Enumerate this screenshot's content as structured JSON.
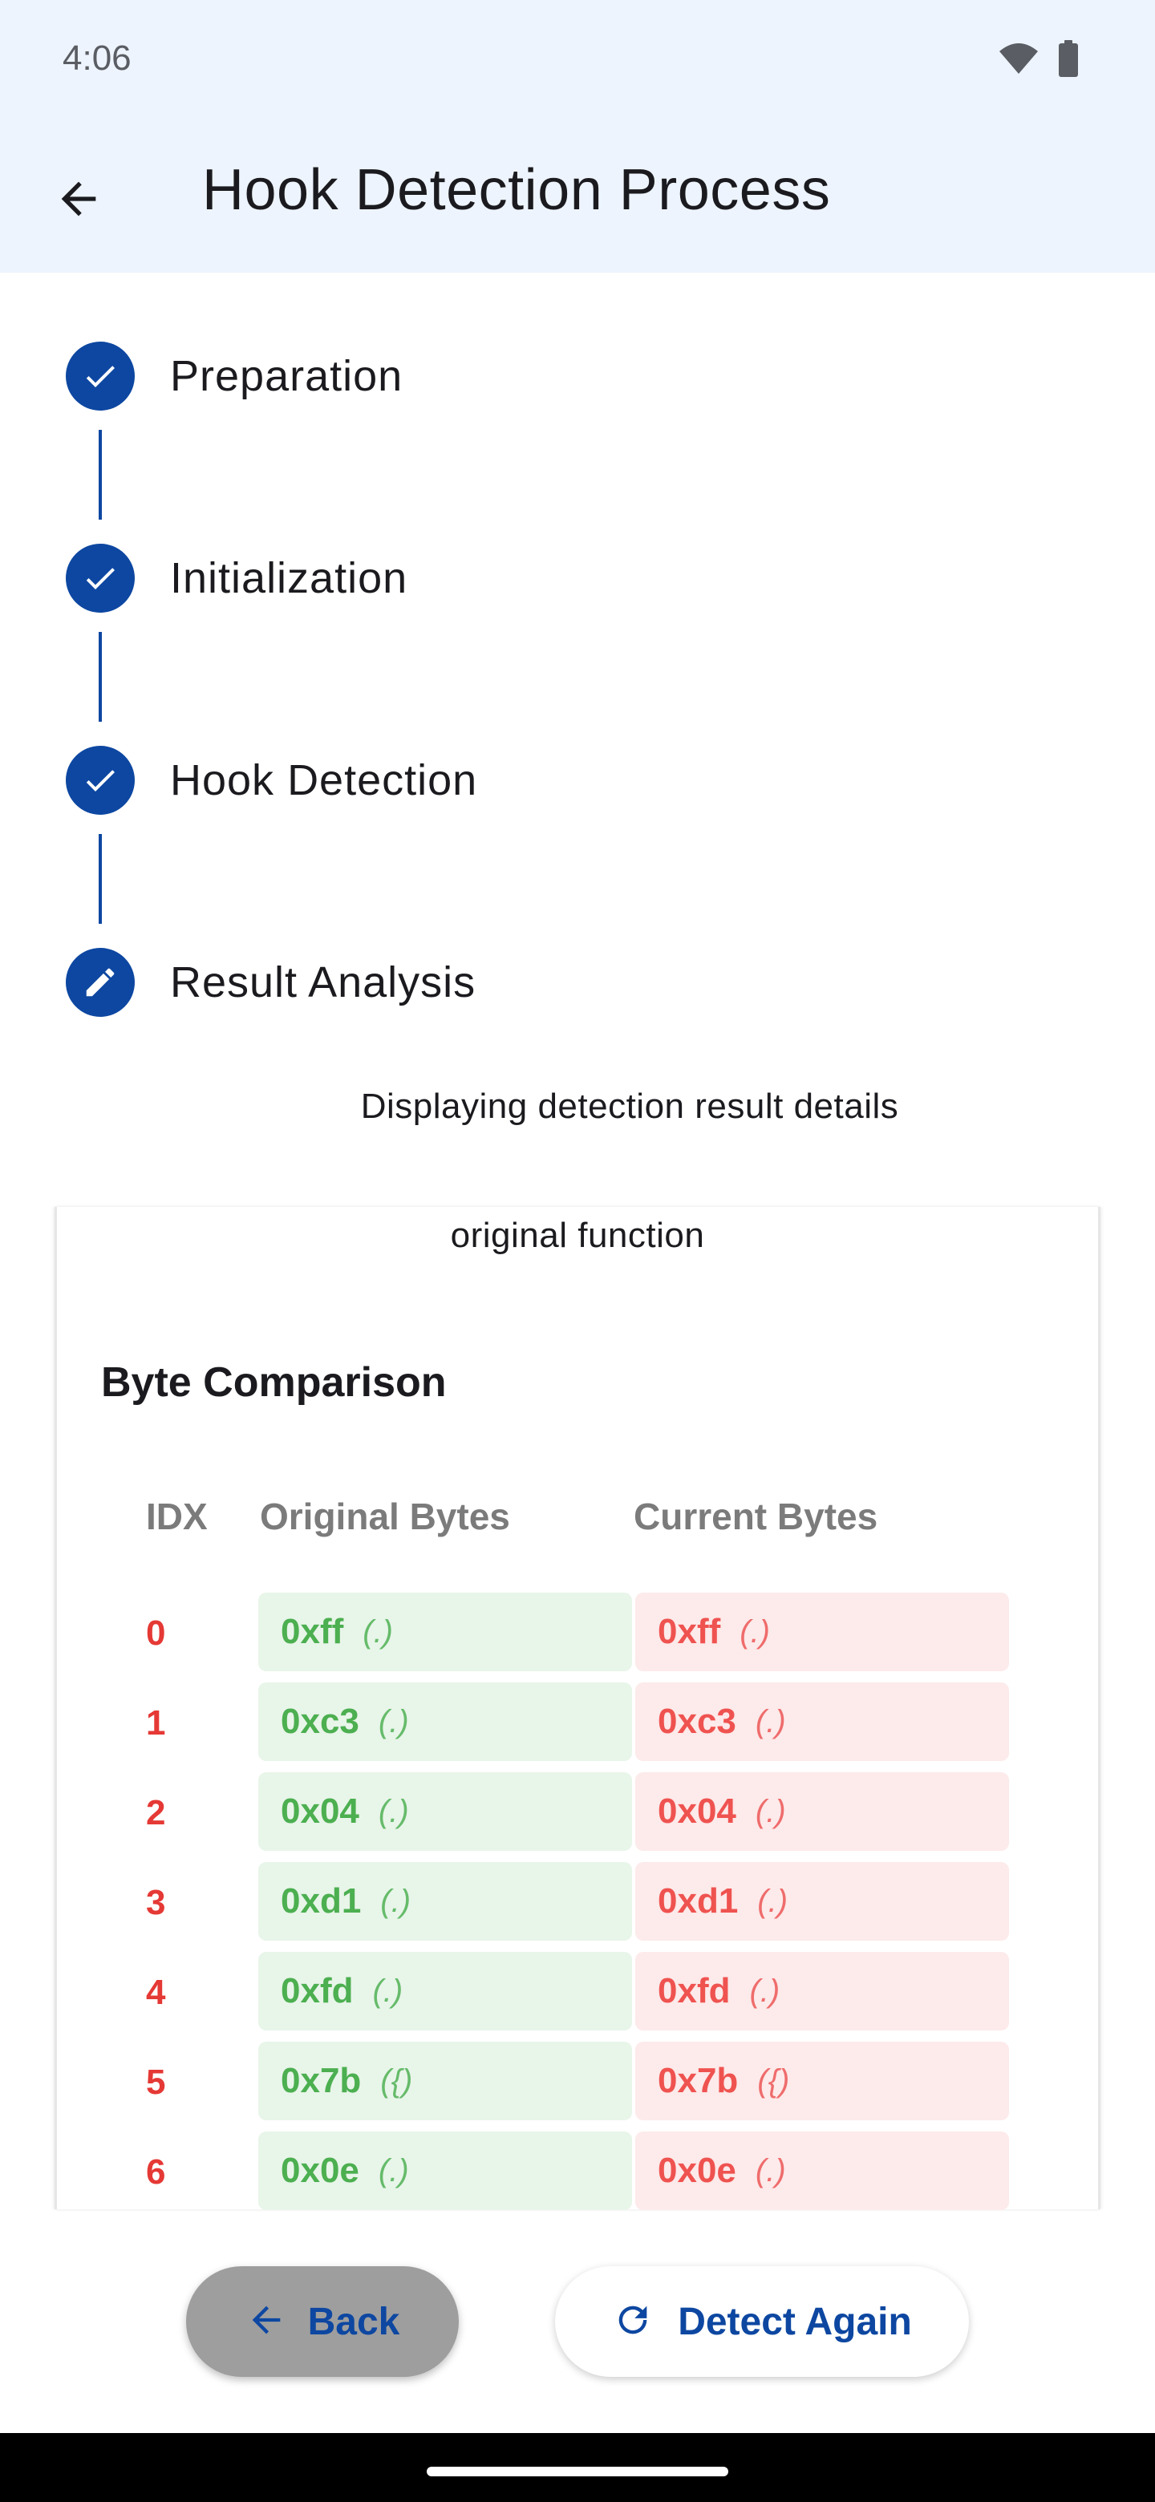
{
  "status_bar": {
    "time": "4:06",
    "icons": [
      "wifi-icon",
      "battery-icon"
    ]
  },
  "app_bar": {
    "title": "Hook Detection Process",
    "back_icon": "arrow-left-icon"
  },
  "stepper": {
    "steps": [
      {
        "label": "Preparation",
        "state": "done",
        "icon": "check-icon"
      },
      {
        "label": "Initialization",
        "state": "done",
        "icon": "check-icon"
      },
      {
        "label": "Hook Detection",
        "state": "done",
        "icon": "check-icon"
      },
      {
        "label": "Result Analysis",
        "state": "editing",
        "icon": "pencil-icon"
      }
    ],
    "caption": "Displaying detection result details"
  },
  "card": {
    "top_text": "original function",
    "section_title": "Byte Comparison",
    "headers": {
      "idx": "IDX",
      "original": "Original Bytes",
      "current": "Current Bytes"
    },
    "rows": [
      {
        "idx": "0",
        "orig_hex": "0xff",
        "orig_char": "(.)",
        "cur_hex": "0xff",
        "cur_char": "(.)"
      },
      {
        "idx": "1",
        "orig_hex": "0xc3",
        "orig_char": "(.)",
        "cur_hex": "0xc3",
        "cur_char": "(.)"
      },
      {
        "idx": "2",
        "orig_hex": "0x04",
        "orig_char": "(.)",
        "cur_hex": "0x04",
        "cur_char": "(.)"
      },
      {
        "idx": "3",
        "orig_hex": "0xd1",
        "orig_char": "(.)",
        "cur_hex": "0xd1",
        "cur_char": "(.)"
      },
      {
        "idx": "4",
        "orig_hex": "0xfd",
        "orig_char": "(.)",
        "cur_hex": "0xfd",
        "cur_char": "(.)"
      },
      {
        "idx": "5",
        "orig_hex": "0x7b",
        "orig_char": "({)",
        "cur_hex": "0x7b",
        "cur_char": "({)"
      },
      {
        "idx": "6",
        "orig_hex": "0x0e",
        "orig_char": "(.)",
        "cur_hex": "0x0e",
        "cur_char": "(.)"
      }
    ]
  },
  "buttons": {
    "back": "Back",
    "detect_again": "Detect Again"
  },
  "colors": {
    "primary": "#0d47a1",
    "match_green": "#4caf50",
    "mismatch_red": "#e53935",
    "app_bar_bg": "#edf4fd"
  }
}
